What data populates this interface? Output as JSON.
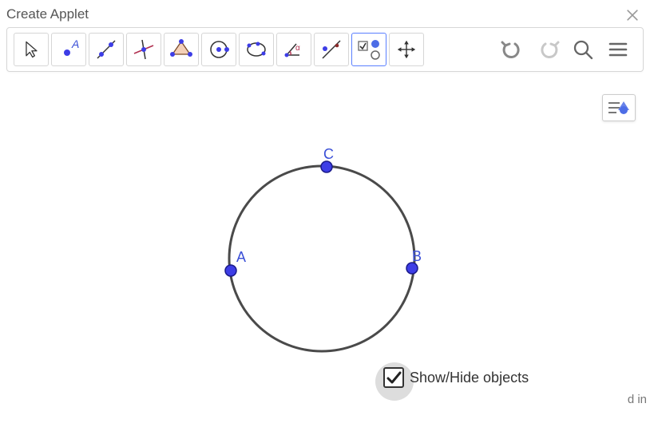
{
  "title": "Create Applet",
  "points": {
    "A": {
      "label": "A"
    },
    "B": {
      "label": "B"
    },
    "C": {
      "label": "C"
    }
  },
  "showhide": {
    "label": "Show/Hide objects",
    "checked": true
  },
  "aux": {
    "login_fragment": "d in"
  },
  "tools": [
    "move-tool",
    "point-tool",
    "line-tool",
    "perpendicular-tool",
    "polygon-tool",
    "circle-tool",
    "conic-tool",
    "angle-tool",
    "reflect-tool",
    "slider-tool",
    "move-view-tool"
  ]
}
